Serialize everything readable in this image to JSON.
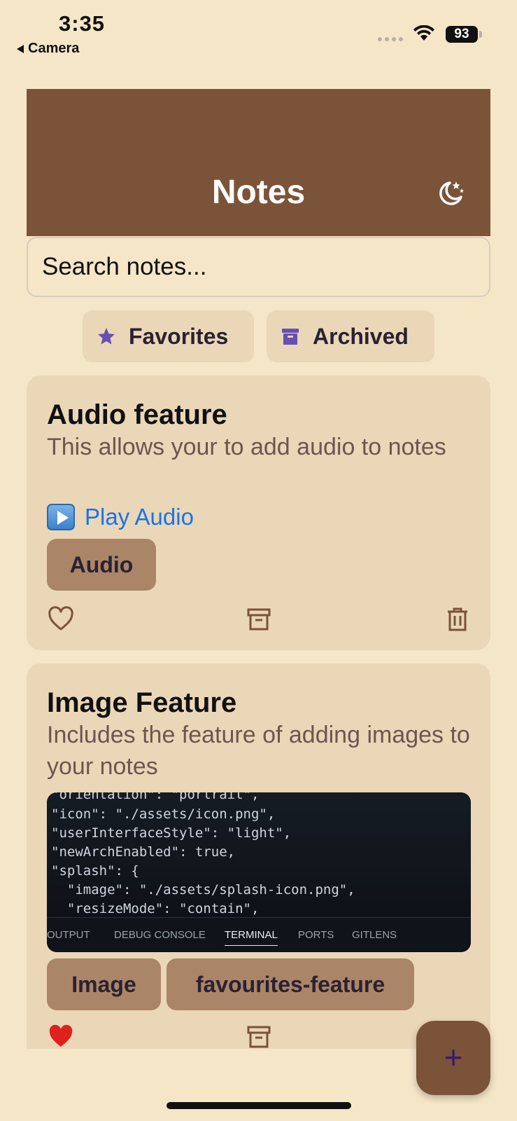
{
  "status_bar": {
    "time": "3:35",
    "back_app": "Camera",
    "battery": "93"
  },
  "header": {
    "title": "Notes",
    "theme_icon": "moon-stars-icon"
  },
  "search": {
    "placeholder": "Search notes..."
  },
  "filters": [
    {
      "label": "Favorites",
      "icon": "star-icon",
      "icon_color": "#6a4fb0"
    },
    {
      "label": "Archived",
      "icon": "archive-icon",
      "icon_color": "#6a4fb0"
    }
  ],
  "notes": [
    {
      "title": "Audio feature",
      "description": "This allows your to add audio to notes",
      "audio_label": "Play Audio",
      "tags": [
        "Audio"
      ],
      "favorited": false
    },
    {
      "title": "Image Feature",
      "description": "Includes the feature of adding images to your notes",
      "image_code_lines": [
        "\"orientation\": \"portrait\",",
        "\"icon\": \"./assets/icon.png\",",
        "\"userInterfaceStyle\": \"light\",",
        "\"newArchEnabled\": true,",
        "\"splash\": {",
        "  \"image\": \"./assets/splash-icon.png\",",
        "  \"resizeMode\": \"contain\","
      ],
      "image_panel_tabs": [
        "OUTPUT",
        "DEBUG CONSOLE",
        "TERMINAL",
        "PORTS",
        "GITLENS"
      ],
      "image_active_tab": "TERMINAL",
      "tags": [
        "Image",
        "favourites-feature"
      ],
      "favorited": true
    }
  ],
  "fab": {
    "label": "+"
  },
  "colors": {
    "background": "#f5e6c8",
    "header": "#7b5339",
    "card": "#ead7b8",
    "tag": "#ab8567",
    "link": "#1a73e8",
    "favorite": "#e0201b",
    "action_icon": "#7b5339"
  }
}
